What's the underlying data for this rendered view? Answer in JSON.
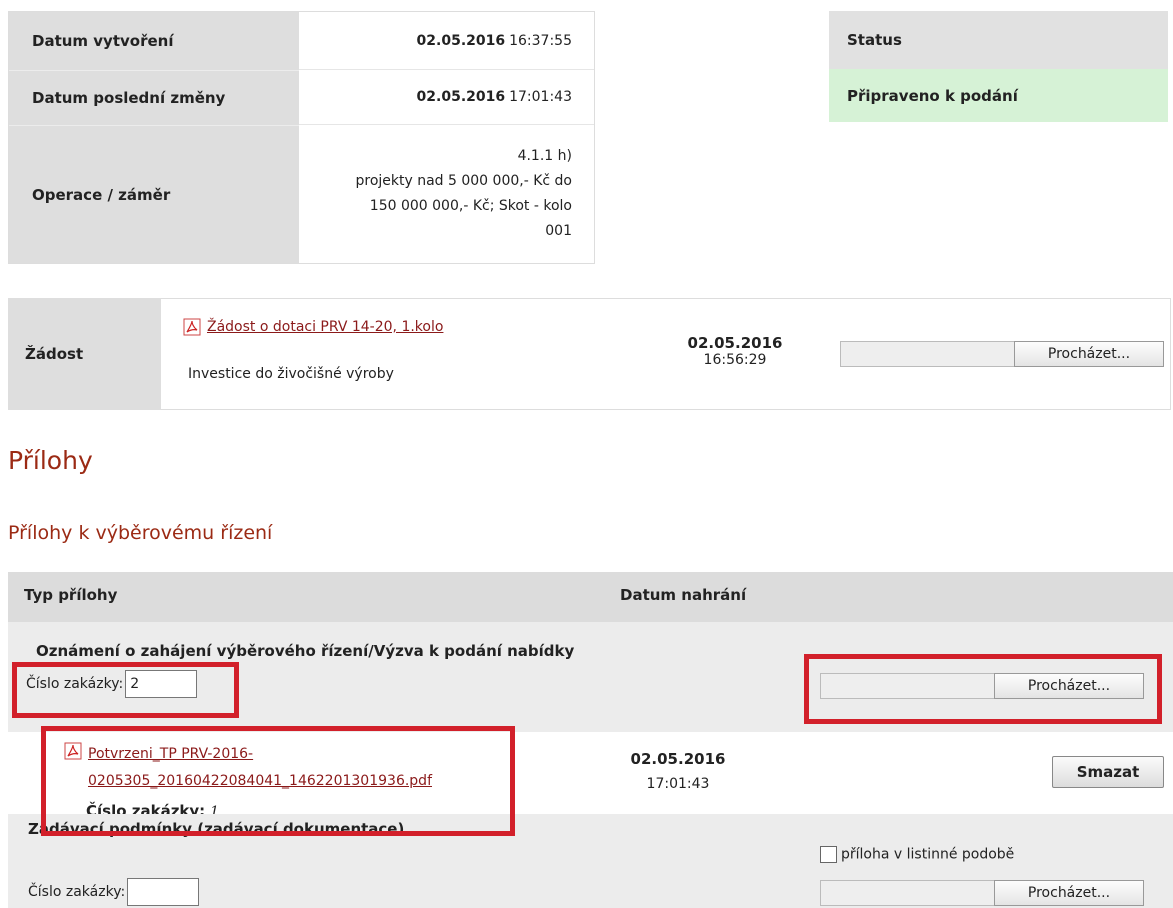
{
  "info": {
    "created_label": "Datum vytvoření",
    "created_date": "02.05.2016",
    "created_time": "16:37:55",
    "modified_label": "Datum poslední změny",
    "modified_date": "02.05.2016",
    "modified_time": "17:01:43",
    "operation_label": "Operace / záměr",
    "operation_value": "4.1.1 h)\nprojekty nad 5 000 000,- Kč do\n150 000 000,- Kč; Skot - kolo\n001"
  },
  "status": {
    "label": "Status",
    "value": "Připraveno k podání"
  },
  "application": {
    "label": "Žádost",
    "link": "Žádost o dotaci PRV 14-20, 1.kolo",
    "description": "Investice do živočišné výroby",
    "date": "02.05.2016",
    "time": "16:56:29",
    "browse_label": "Procházet..."
  },
  "attachments": {
    "heading": "Přílohy",
    "subheading": "Přílohy k výběrovému řízení",
    "col_type": "Typ přílohy",
    "col_date": "Datum nahrání",
    "group1": {
      "title": "Oznámení o zahájení výběrového řízení/Výzva k podání nabídky",
      "order_label": "Číslo zakázky:",
      "order_value": "2",
      "browse_label": "Procházet..."
    },
    "file": {
      "name_line1": "Potvrzeni_TP PRV-2016-",
      "name_line2": "0205305_20160422084041_1462201301936.pdf",
      "order_label": "Číslo zakázky:",
      "order_value": "1",
      "date": "02.05.2016",
      "time": "17:01:43",
      "delete_label": "Smazat"
    },
    "group2": {
      "title": "Zadávací podmínky (zadávací dokumentace)",
      "order_label": "Číslo zakázky:",
      "order_value": "",
      "paper_label": "příloha v listinné podobě",
      "browse_label": "Procházet..."
    }
  },
  "colors": {
    "accent": "#9b2a14",
    "highlight_red": "#d2202a",
    "status_green": "#d6f2d6"
  }
}
